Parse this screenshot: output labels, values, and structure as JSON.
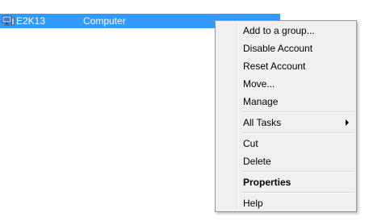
{
  "list": {
    "selected_row": {
      "name": "E2K13",
      "type": "Computer",
      "icon": "computer-icon"
    }
  },
  "colors": {
    "selection": "#3399ff",
    "menu_background": "#f0f0f0",
    "menu_border": "#979797"
  },
  "context_menu": {
    "items": [
      {
        "label": "Add to a group..."
      },
      {
        "label": "Disable Account"
      },
      {
        "label": "Reset Account"
      },
      {
        "label": "Move..."
      },
      {
        "label": "Manage"
      },
      {
        "label": "All Tasks",
        "submenu": true
      },
      {
        "label": "Cut"
      },
      {
        "label": "Delete"
      },
      {
        "label": "Properties",
        "default": true
      },
      {
        "label": "Help"
      }
    ]
  }
}
